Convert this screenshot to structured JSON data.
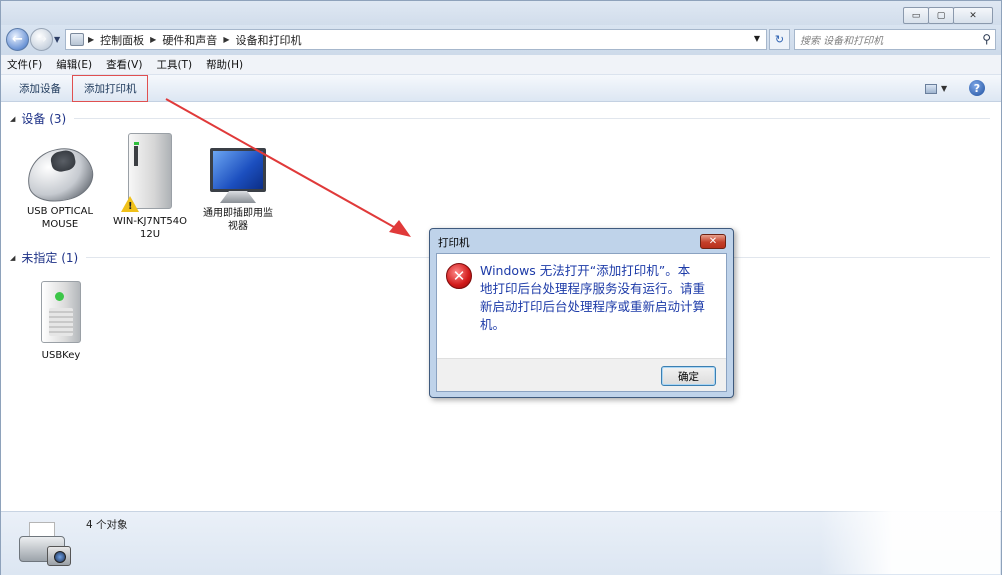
{
  "window": {
    "minimize": "▭",
    "maximize": "▢",
    "close": "✕"
  },
  "address": {
    "crumbs": [
      "控制面板",
      "硬件和声音",
      "设备和打印机"
    ]
  },
  "search": {
    "placeholder": "搜索 设备和打印机"
  },
  "menu": {
    "file": "文件(F)",
    "edit": "编辑(E)",
    "view": "查看(V)",
    "tools": "工具(T)",
    "help": "帮助(H)"
  },
  "toolbar": {
    "add_device": "添加设备",
    "add_printer": "添加打印机"
  },
  "groups": {
    "devices": {
      "label": "设备 (3)",
      "items": [
        {
          "name_line1": "USB OPTICAL",
          "name_line2": "MOUSE"
        },
        {
          "name_line1": "WIN-KJ7NT54O",
          "name_line2": "12U"
        },
        {
          "name_line1": "通用即插即用监",
          "name_line2": "视器"
        }
      ]
    },
    "unspecified": {
      "label": "未指定 (1)",
      "items": [
        {
          "name_line1": "USBKey"
        }
      ]
    }
  },
  "status": {
    "count_text": "4 个对象"
  },
  "dialog": {
    "title": "打印机",
    "close": "✕",
    "message_line1": "Windows 无法打开“添加打印机”。本",
    "message_line2": "地打印后台处理程序服务没有运行。请重",
    "message_line3": "新启动打印后台处理程序或重新启动计算",
    "message_line4": "机。",
    "ok": "确定"
  },
  "colors": {
    "accent_blue": "#1d3ba8",
    "highlight_red": "#e05050",
    "error_red": "#d11a1a"
  }
}
